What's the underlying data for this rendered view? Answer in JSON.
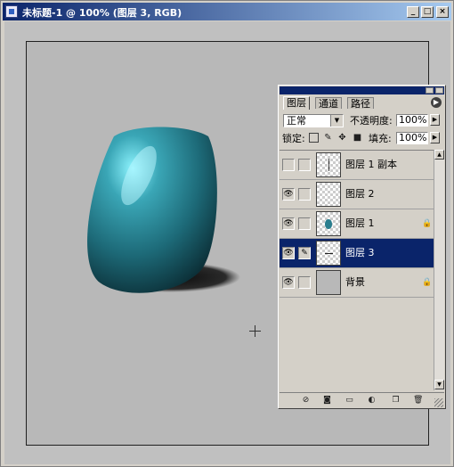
{
  "window": {
    "title": "未标题-1 @ 100% (图层 3, RGB)",
    "controls": {
      "minimize": "_",
      "maximize": "□",
      "close": "×"
    }
  },
  "panel": {
    "tabs": [
      "图层",
      "通道",
      "路径"
    ],
    "blend_mode": "正常",
    "opacity_label": "不透明度:",
    "opacity_value": "100%",
    "lock_label": "锁定:",
    "fill_label": "填充:",
    "fill_value": "100%",
    "layers": [
      {
        "name": "图层 1 副本",
        "visible": false,
        "selected": false,
        "locked": false
      },
      {
        "name": "图层 2",
        "visible": true,
        "selected": false,
        "locked": false
      },
      {
        "name": "图层 1",
        "visible": true,
        "selected": false,
        "locked": true
      },
      {
        "name": "图层 3",
        "visible": true,
        "selected": true,
        "locked": false
      },
      {
        "name": "背景",
        "visible": true,
        "selected": false,
        "locked": true
      }
    ]
  },
  "colors": {
    "titlebar": "#0a246a",
    "vase": "#2f8c9c",
    "selected_layer": "#0a246a"
  }
}
